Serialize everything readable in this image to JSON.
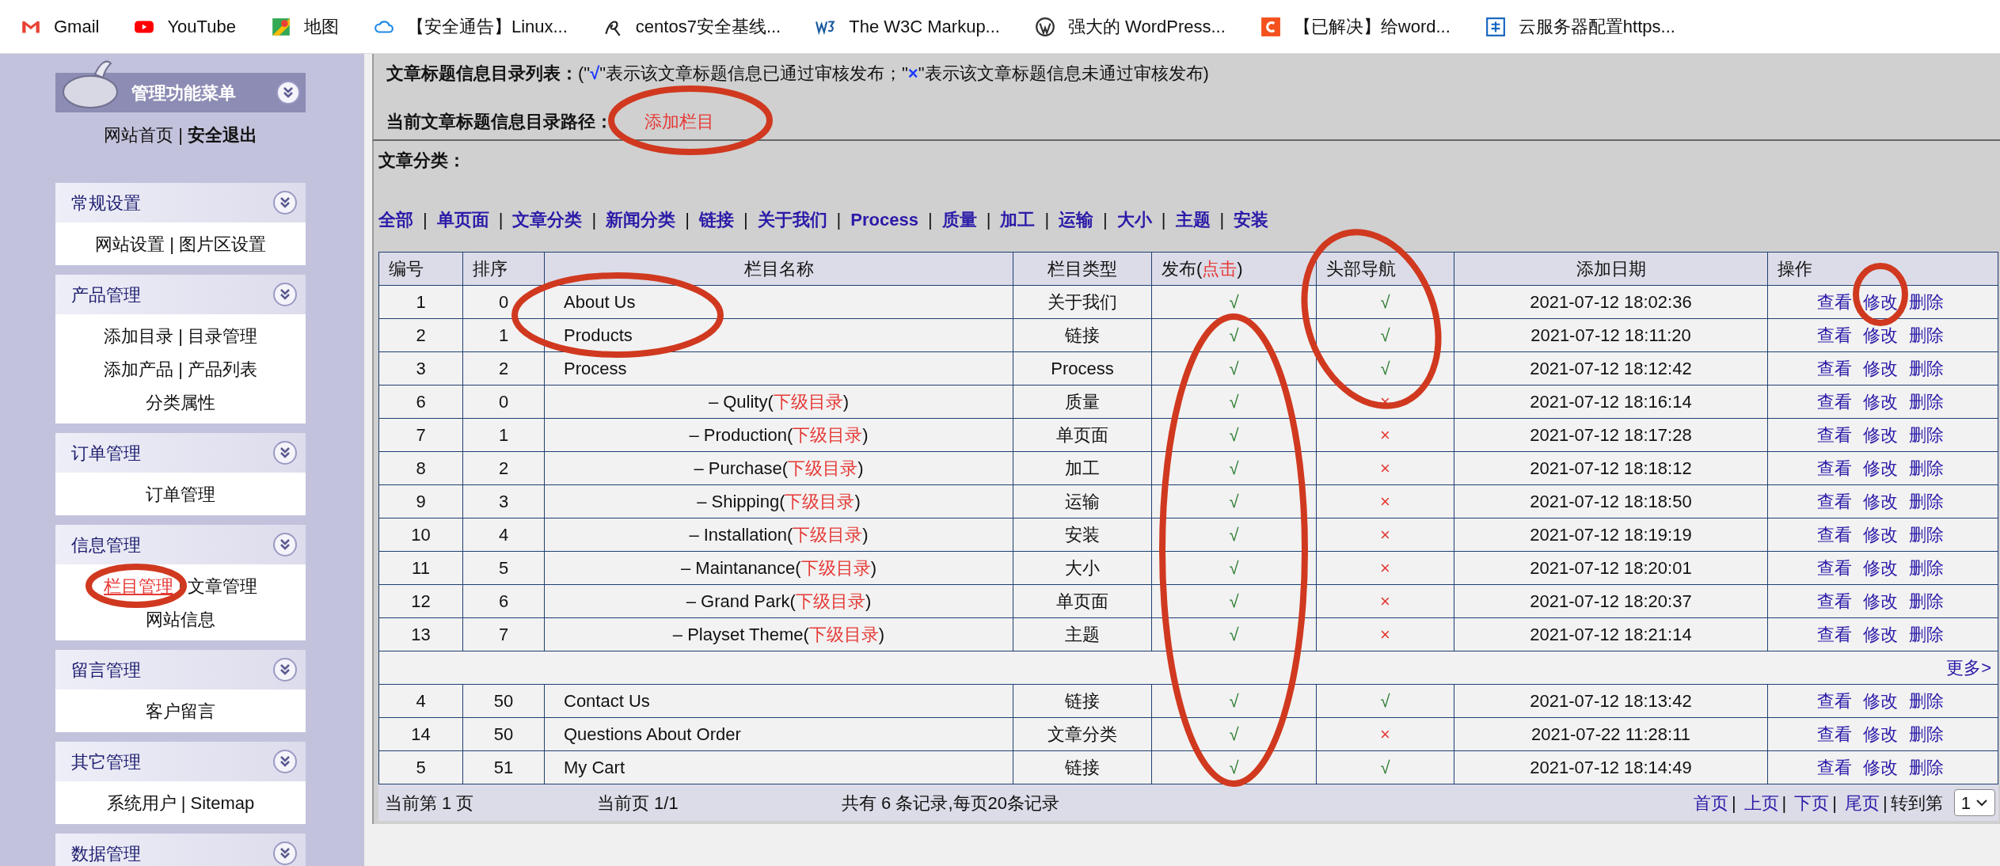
{
  "bookmarks": [
    {
      "label": "Gmail"
    },
    {
      "label": "YouTube"
    },
    {
      "label": "地图"
    },
    {
      "label": "【安全通告】Linux..."
    },
    {
      "label": "centos7安全基线..."
    },
    {
      "label": "The W3C Markup..."
    },
    {
      "label": "强大的 WordPress..."
    },
    {
      "label": "【已解决】给word..."
    },
    {
      "label": "云服务器配置https..."
    }
  ],
  "sidebar": {
    "title": "管理功能菜单",
    "top_links": [
      {
        "text": "网站首页",
        "bold": false
      },
      {
        "text": "安全退出",
        "bold": true
      }
    ],
    "separator": "|",
    "panels": [
      {
        "title": "常规设置",
        "lines": [
          [
            {
              "text": "网站设置",
              "selected": false
            },
            {
              "text": "图片区设置",
              "selected": false
            }
          ]
        ]
      },
      {
        "title": "产品管理",
        "lines": [
          [
            {
              "text": "添加目录",
              "selected": false
            },
            {
              "text": "目录管理",
              "selected": false
            }
          ],
          [
            {
              "text": "添加产品",
              "selected": false
            },
            {
              "text": "产品列表",
              "selected": false
            }
          ],
          [
            {
              "text": "分类属性",
              "selected": false
            }
          ]
        ]
      },
      {
        "title": "订单管理",
        "lines": [
          [
            {
              "text": "订单管理",
              "selected": false
            }
          ]
        ]
      },
      {
        "title": "信息管理",
        "lines": [
          [
            {
              "text": "栏目管理",
              "selected": true
            },
            {
              "text": "文章管理",
              "selected": false
            }
          ],
          [
            {
              "text": "网站信息",
              "selected": false
            }
          ]
        ]
      },
      {
        "title": "留言管理",
        "lines": [
          [
            {
              "text": "客户留言",
              "selected": false
            }
          ]
        ]
      },
      {
        "title": "其它管理",
        "lines": [
          [
            {
              "text": "系统用户",
              "selected": false
            },
            {
              "text": "Sitemap",
              "selected": false
            }
          ]
        ]
      },
      {
        "title": "数据管理"
      }
    ]
  },
  "legend": {
    "label": "文章标题信息目录列表：",
    "parts": [
      {
        "text": "(\"",
        "kind": "plain"
      },
      {
        "text": "√",
        "kind": "symbol"
      },
      {
        "text": "\"表示该文章标题信息已通过审核发布；\"",
        "kind": "plain"
      },
      {
        "text": "×",
        "kind": "symbol"
      },
      {
        "text": "\"表示该文章标题信息未通过审核发布)",
        "kind": "plain"
      }
    ]
  },
  "path": {
    "label": "当前文章标题信息目录路径：",
    "link": "添加栏目"
  },
  "categories": {
    "label": "文章分类：",
    "separator": "|",
    "items": [
      "全部",
      "单页面",
      "文章分类",
      "新闻分类",
      "链接",
      "关于我们",
      "Process",
      "质量",
      "加工",
      "运输",
      "大小",
      "主题",
      "安装"
    ]
  },
  "table": {
    "marks": {
      "yes": "√",
      "no": "×"
    },
    "columns": [
      {
        "label": "编号"
      },
      {
        "label": "排序"
      },
      {
        "label": "栏目名称"
      },
      {
        "label": "栏目类型"
      },
      {
        "label": "发布(",
        "link": "点击",
        "suffix": ")"
      },
      {
        "label": "头部导航"
      },
      {
        "label": "添加日期"
      },
      {
        "label": "操作"
      }
    ],
    "rows": [
      {
        "kind": "top",
        "id": "1",
        "order": "0",
        "name": "About Us",
        "type": "关于我们",
        "published": true,
        "nav": true,
        "date": "2021-07-12 18:02:36",
        "actions": [
          "查看",
          "修改",
          "删除"
        ]
      },
      {
        "kind": "top",
        "id": "2",
        "order": "1",
        "name": "Products",
        "type": "链接",
        "published": true,
        "nav": true,
        "date": "2021-07-12 18:11:20",
        "actions": [
          "查看",
          "修改",
          "删除"
        ]
      },
      {
        "kind": "top",
        "id": "3",
        "order": "2",
        "name": "Process",
        "type": "Process",
        "published": true,
        "nav": true,
        "date": "2021-07-12 18:12:42",
        "actions": [
          "查看",
          "修改",
          "删除"
        ]
      },
      {
        "kind": "child",
        "id": "6",
        "order": "0",
        "name": "– Qulity(",
        "parts": [
          {
            "text": "下级目录",
            "kind": "link"
          },
          {
            "text": ")",
            "kind": "plain"
          }
        ],
        "type": "质量",
        "published": true,
        "nav": false,
        "date": "2021-07-12 18:16:14",
        "actions": [
          "查看",
          "修改",
          "删除"
        ]
      },
      {
        "kind": "child",
        "id": "7",
        "order": "1",
        "name": "– Production(",
        "parts": [
          {
            "text": "下级目录",
            "kind": "link"
          },
          {
            "text": ")",
            "kind": "plain"
          }
        ],
        "type": "单页面",
        "published": true,
        "nav": false,
        "date": "2021-07-12 18:17:28",
        "actions": [
          "查看",
          "修改",
          "删除"
        ]
      },
      {
        "kind": "child",
        "id": "8",
        "order": "2",
        "name": "– Purchase(",
        "parts": [
          {
            "text": "下级目录",
            "kind": "link"
          },
          {
            "text": ")",
            "kind": "plain"
          }
        ],
        "type": "加工",
        "published": true,
        "nav": false,
        "date": "2021-07-12 18:18:12",
        "actions": [
          "查看",
          "修改",
          "删除"
        ]
      },
      {
        "kind": "child",
        "id": "9",
        "order": "3",
        "name": "– Shipping(",
        "parts": [
          {
            "text": "下级目录",
            "kind": "link"
          },
          {
            "text": ")",
            "kind": "plain"
          }
        ],
        "type": "运输",
        "published": true,
        "nav": false,
        "date": "2021-07-12 18:18:50",
        "actions": [
          "查看",
          "修改",
          "删除"
        ]
      },
      {
        "kind": "child",
        "id": "10",
        "order": "4",
        "name": "– Installation(",
        "parts": [
          {
            "text": "下级目录",
            "kind": "link"
          },
          {
            "text": ")",
            "kind": "plain"
          }
        ],
        "type": "安装",
        "published": true,
        "nav": false,
        "date": "2021-07-12 18:19:19",
        "actions": [
          "查看",
          "修改",
          "删除"
        ]
      },
      {
        "kind": "child",
        "id": "11",
        "order": "5",
        "name": "– Maintanance(",
        "parts": [
          {
            "text": "下级目录",
            "kind": "link"
          },
          {
            "text": ")",
            "kind": "plain"
          }
        ],
        "type": "大小",
        "published": true,
        "nav": false,
        "date": "2021-07-12 18:20:01",
        "actions": [
          "查看",
          "修改",
          "删除"
        ]
      },
      {
        "kind": "child",
        "id": "12",
        "order": "6",
        "name": "– Grand Park(",
        "parts": [
          {
            "text": "下级目录",
            "kind": "link"
          },
          {
            "text": ")",
            "kind": "plain"
          }
        ],
        "type": "单页面",
        "published": true,
        "nav": false,
        "date": "2021-07-12 18:20:37",
        "actions": [
          "查看",
          "修改",
          "删除"
        ]
      },
      {
        "kind": "child",
        "id": "13",
        "order": "7",
        "name": "– Playset Theme(",
        "parts": [
          {
            "text": "下级目录",
            "kind": "link"
          },
          {
            "text": ")",
            "kind": "plain"
          }
        ],
        "type": "主题",
        "published": true,
        "nav": false,
        "date": "2021-07-12 18:21:14",
        "actions": [
          "查看",
          "修改",
          "删除"
        ]
      },
      {
        "kind": "more",
        "text": "更多>"
      },
      {
        "kind": "top",
        "id": "4",
        "order": "50",
        "name": "Contact Us",
        "type": "链接",
        "published": true,
        "nav": true,
        "date": "2021-07-12 18:13:42",
        "actions": [
          "查看",
          "修改",
          "删除"
        ]
      },
      {
        "kind": "top",
        "id": "14",
        "order": "50",
        "name": "Questions About Order",
        "type": "文章分类",
        "published": true,
        "nav": false,
        "date": "2021-07-22 11:28:11",
        "actions": [
          "查看",
          "修改",
          "删除"
        ]
      },
      {
        "kind": "top",
        "id": "5",
        "order": "51",
        "name": "My Cart",
        "type": "链接",
        "published": true,
        "nav": true,
        "date": "2021-07-12 18:14:49",
        "actions": [
          "查看",
          "修改",
          "删除"
        ]
      }
    ]
  },
  "footer": {
    "current_page": "当前第 1 页",
    "page_of": "当前页 1/1",
    "total": "共有 6 条记录,每页20条记录",
    "links": [
      "首页",
      "上页",
      "下页",
      "尾页"
    ],
    "separator": "|",
    "goto_label": "转到第",
    "page_select": "1"
  }
}
